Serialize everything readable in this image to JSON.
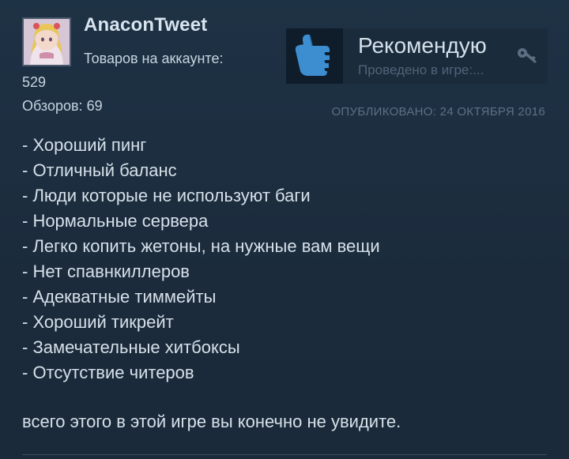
{
  "author": {
    "name": "AnaconTweet",
    "products_label": "Товаров на аккаунте:",
    "products_value": "529",
    "reviews_label": "Обзоров: 69"
  },
  "recommendation": {
    "title": "Рекомендую",
    "playtime": "Проведено в игре:...",
    "thumb_icon": "thumbs-up-icon",
    "key_icon": "key-icon",
    "accent_color": "#3d8ed1"
  },
  "published": "ОПУБЛИКОВАНО: 24 ОКТЯБРЯ 2016",
  "review_lines": [
    "- Хороший пинг",
    "- Отличный баланс",
    "- Люди которые не используют баги",
    "- Нормальные сервера",
    "- Легко копить жетоны, на нужные вам вещи",
    "- Нет спавнкиллеров",
    "- Адекватные тиммейты",
    "- Хороший тикрейт",
    "- Замечательные хитбоксы",
    "- Отсутствие читеров"
  ],
  "conclusion": "всего этого в этой игре вы конечно не увидите."
}
